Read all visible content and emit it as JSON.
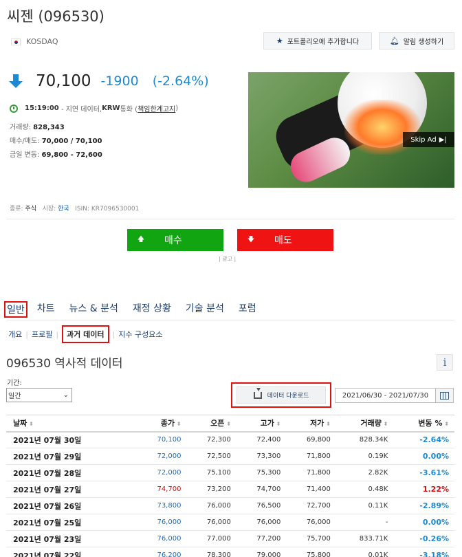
{
  "stock": {
    "title": "씨젠 (096530)",
    "exchange": "KOSDAQ",
    "portfolio_btn": "포트폴리오에 추가합니다",
    "alert_btn": "알림 생성하기",
    "price": "70,100",
    "change": "-1900",
    "change_pct": "(-2.64%)",
    "time": "15:19:00",
    "time_note": "- 지연 데이터, ",
    "currency": "KRW",
    "currency_suffix": " 통화 ( ",
    "disclaimer": "책임한계고지",
    "disclaimer_suffix": " )",
    "volume_label": "거래량: ",
    "volume": "828,343",
    "bidask_label": "매수/매도: ",
    "bidask": "70,000 / 70,100",
    "range_label": "금일 변동: ",
    "range": "69,800 - 72,600",
    "type_label": "종류: ",
    "type": "주식",
    "market_label": "시장: ",
    "market": "한국",
    "isin_label": "ISIN: ",
    "isin": "KR7096530001"
  },
  "ad": {
    "skip_label": "Skip Ad",
    "caption": "| 광고 |"
  },
  "actions": {
    "buy": "매수",
    "sell": "매도"
  },
  "tabs": [
    "일반",
    "차트",
    "뉴스 & 분석",
    "재정 상황",
    "기술 분석",
    "포럼"
  ],
  "subtabs": [
    "개요",
    "프로필",
    "과거 데이터",
    "지수 구성요소"
  ],
  "history": {
    "title": "096530 역사적 데이터",
    "info": "i",
    "period_label": "기간:",
    "period_value": "일간",
    "download_label": "데이터 다운로드",
    "date_range": "2021/06/30 - 2021/07/30",
    "columns": [
      "날짜",
      "종가",
      "오픈",
      "고가",
      "저가",
      "거래량",
      "변동 %"
    ],
    "rows": [
      [
        "2021년 07월 30일",
        "70,100",
        "72,300",
        "72,400",
        "69,800",
        "828.34K",
        "-2.64%"
      ],
      [
        "2021년 07월 29일",
        "72,000",
        "72,500",
        "73,300",
        "71,800",
        "0.19K",
        "0.00%"
      ],
      [
        "2021년 07월 28일",
        "72,000",
        "75,100",
        "75,300",
        "71,800",
        "2.82K",
        "-3.61%"
      ],
      [
        "2021년 07월 27일",
        "74,700",
        "73,200",
        "74,700",
        "71,400",
        "0.48K",
        "1.22%"
      ],
      [
        "2021년 07월 26일",
        "73,800",
        "76,000",
        "76,500",
        "72,700",
        "0.11K",
        "-2.89%"
      ],
      [
        "2021년 07월 25일",
        "76,000",
        "76,000",
        "76,000",
        "76,000",
        "-",
        "0.00%"
      ],
      [
        "2021년 07월 23일",
        "76,000",
        "77,000",
        "77,200",
        "75,700",
        "833.71K",
        "-0.26%"
      ],
      [
        "2021년 07월 22일",
        "76,200",
        "78,300",
        "79,000",
        "75,800",
        "0.01K",
        "-3.18%"
      ]
    ],
    "row_direction": [
      "down",
      "flat",
      "down",
      "up",
      "down",
      "flat",
      "down",
      "down"
    ]
  },
  "colors": {
    "down": "#1c8ad2",
    "up": "#d01010",
    "buy": "#12a512",
    "sell": "#ef1313",
    "highlight": "#e01010"
  }
}
